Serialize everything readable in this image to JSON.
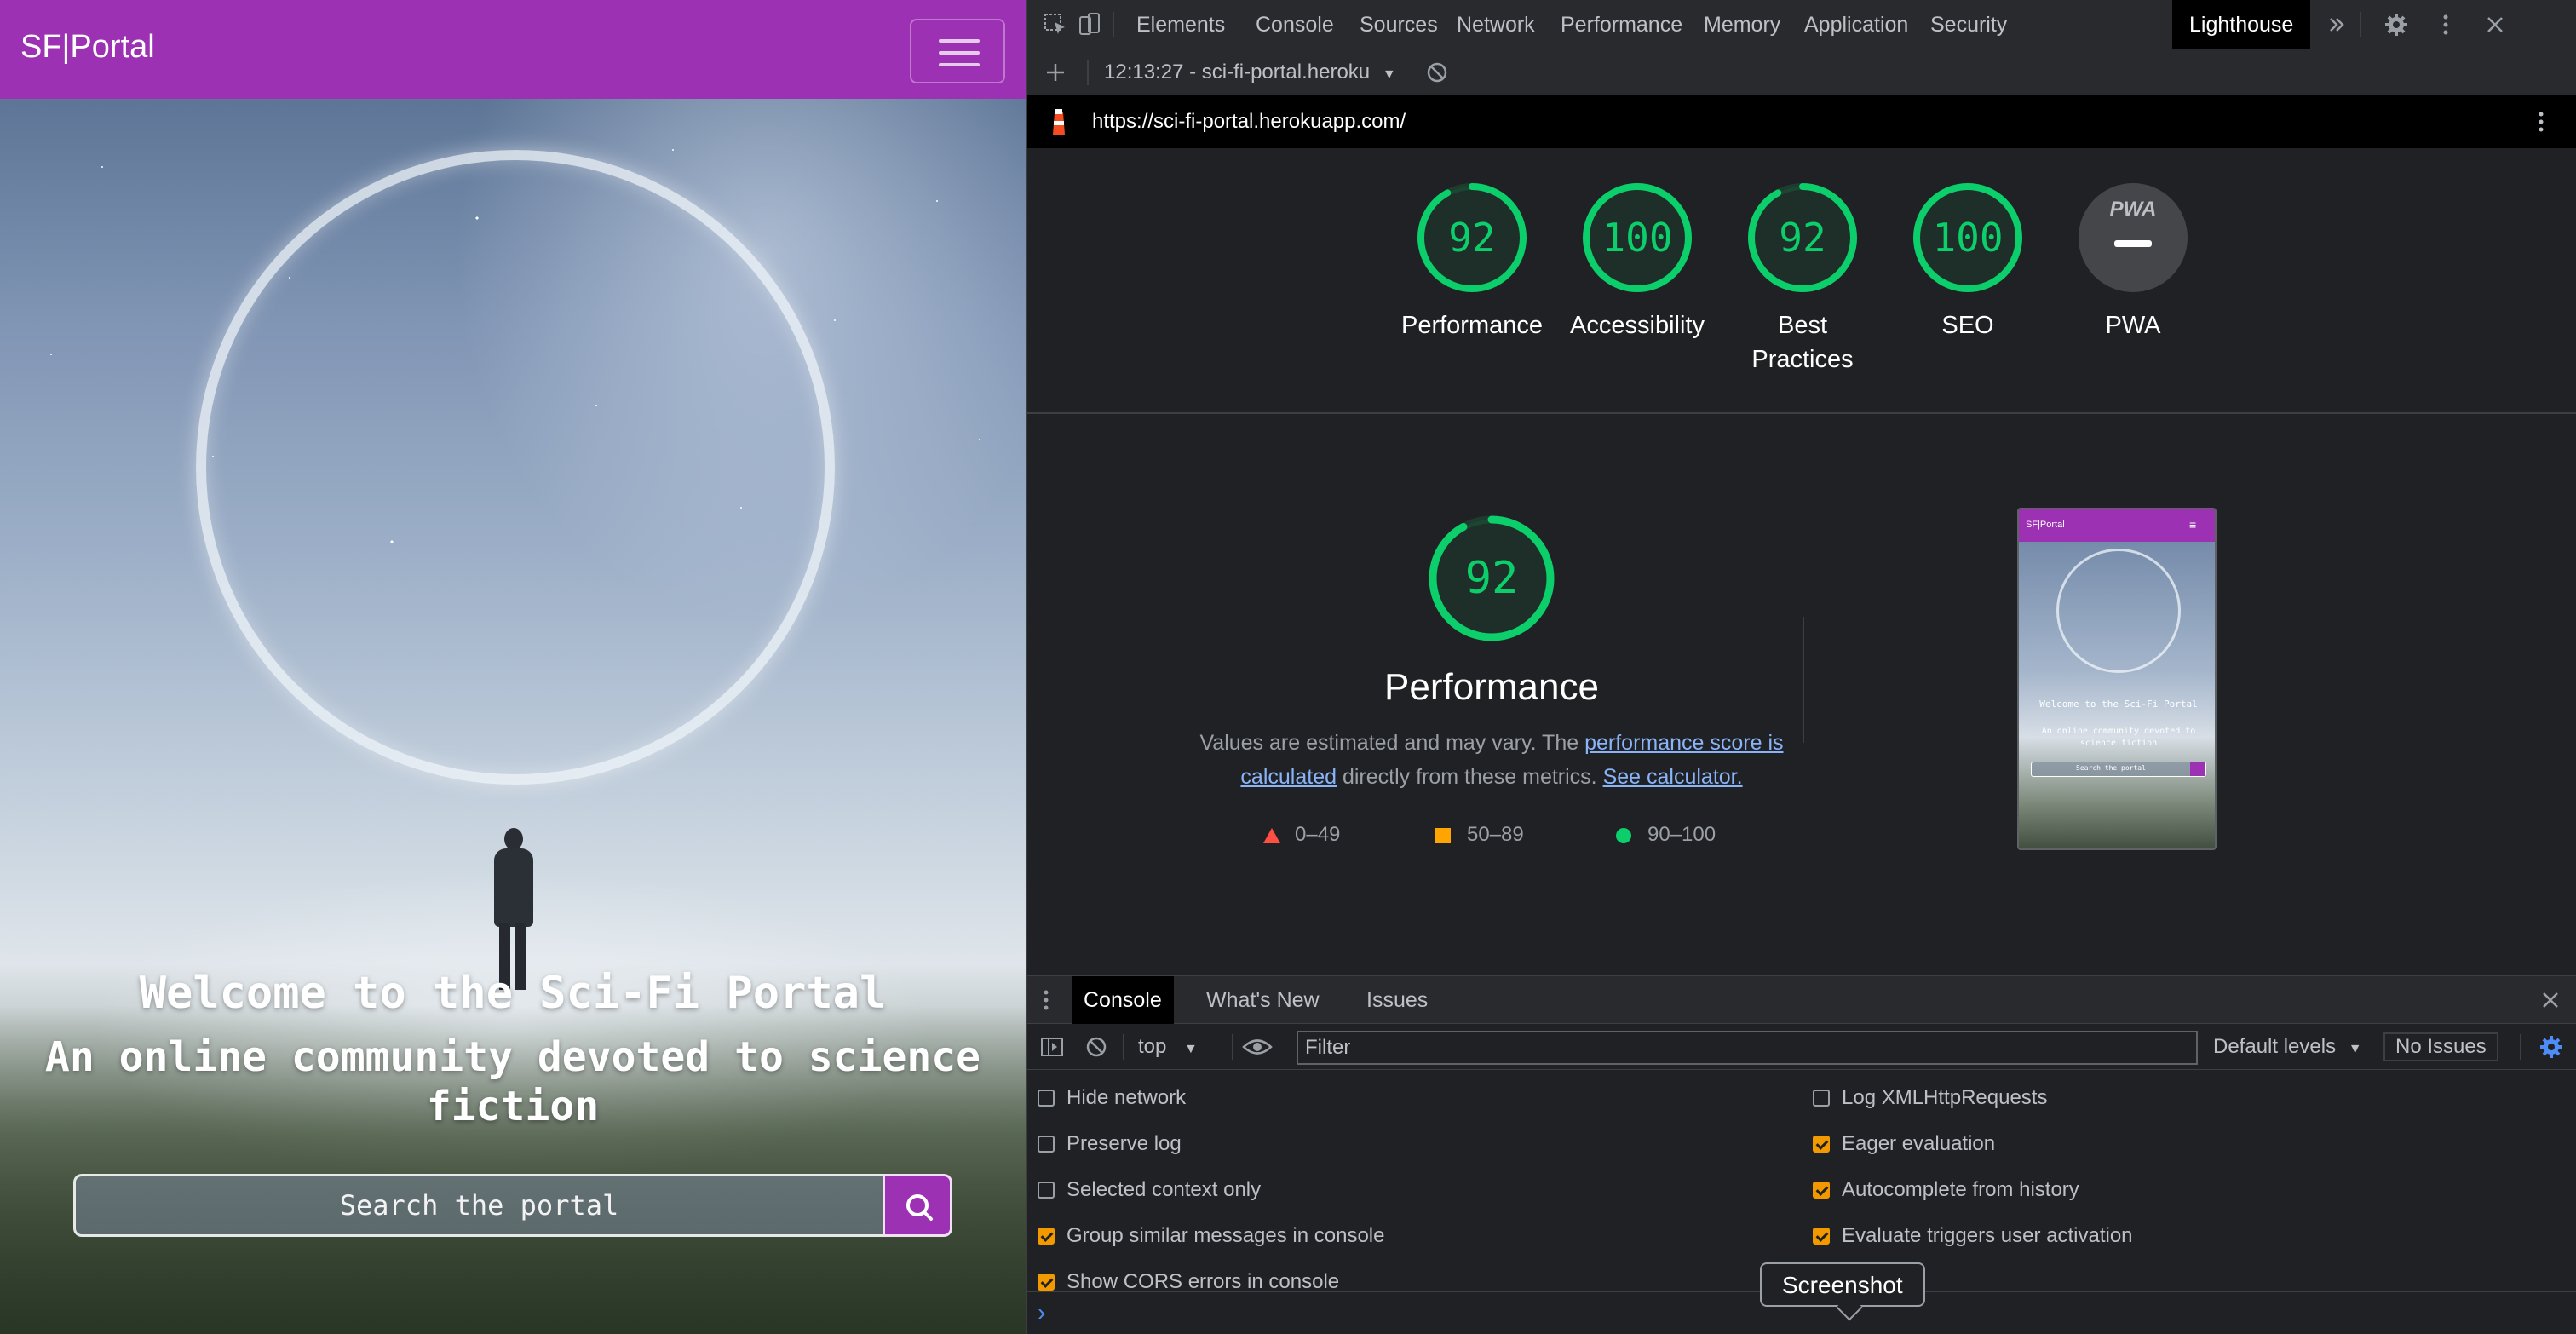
{
  "site": {
    "brand": "SF|Portal",
    "hero_title": "Welcome to the Sci-Fi Portal",
    "hero_subtitle": "An online community devoted to science fiction",
    "search_placeholder": "Search the portal",
    "brand_color": "#9c31b3"
  },
  "devtools": {
    "tabs": [
      "Elements",
      "Console",
      "Sources",
      "Network",
      "Performance",
      "Memory",
      "Application",
      "Security",
      "Lighthouse"
    ],
    "active_tab": "Lighthouse",
    "report_selector": "12:13:27 - sci-fi-portal.heroku",
    "report_url": "https://sci-fi-portal.herokuapp.com/",
    "scores": [
      {
        "label": "Performance",
        "score": "92",
        "value": 92
      },
      {
        "label": "Accessibility",
        "score": "100",
        "value": 100
      },
      {
        "label": "Best Practices",
        "score": "92",
        "value": 92
      },
      {
        "label": "SEO",
        "score": "100",
        "value": 100
      },
      {
        "label": "PWA",
        "score": "",
        "value": null,
        "badge": "PWA"
      }
    ],
    "performance": {
      "score": "92",
      "title": "Performance",
      "desc_prefix": "Values are estimated and may vary. The ",
      "link1": "performance score is calculated",
      "desc_middle": " directly from these metrics. ",
      "link2": "See calculator."
    },
    "legend": [
      {
        "range": "0–49",
        "color": "#ff4e42",
        "shape": "triangle"
      },
      {
        "range": "50–89",
        "color": "#ffa400",
        "shape": "square"
      },
      {
        "range": "90–100",
        "color": "#0cce6b",
        "shape": "circle"
      }
    ],
    "thumbnail": {
      "brand": "SF|Portal",
      "title": "Welcome to the Sci-Fi Portal",
      "subtitle": "An online community devoted to science fiction",
      "search": "Search the portal"
    }
  },
  "console": {
    "tabs": [
      "Console",
      "What's New",
      "Issues"
    ],
    "active_tab": "Console",
    "context": "top",
    "filter_placeholder": "Filter",
    "levels": "Default levels",
    "issues": "No Issues",
    "settings_left": [
      {
        "label": "Hide network",
        "checked": false
      },
      {
        "label": "Preserve log",
        "checked": false
      },
      {
        "label": "Selected context only",
        "checked": false
      },
      {
        "label": "Group similar messages in console",
        "checked": true
      },
      {
        "label": "Show CORS errors in console",
        "checked": true
      }
    ],
    "settings_right": [
      {
        "label": "Log XMLHttpRequests",
        "checked": false
      },
      {
        "label": "Eager evaluation",
        "checked": true
      },
      {
        "label": "Autocomplete from history",
        "checked": true
      },
      {
        "label": "Evaluate triggers user activation",
        "checked": true
      }
    ],
    "prompt": "›",
    "tooltip": "Screenshot"
  }
}
